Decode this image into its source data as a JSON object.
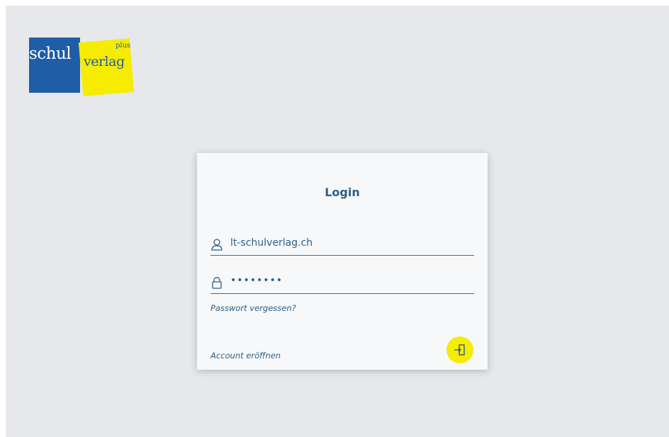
{
  "logo": {
    "part1": "schul",
    "part2": "verlag",
    "part3": "plus"
  },
  "login": {
    "title": "Login",
    "username_value": "lt-schulverlag.ch",
    "password_value": "••••••••",
    "forgot_password_label": "Passwort vergessen?",
    "create_account_label": "Account eröffnen"
  },
  "icons": {
    "user": "user-icon",
    "lock": "lock-icon",
    "login": "login-door-icon"
  },
  "colors": {
    "background": "#e6e8eb",
    "card": "#f7f8f9",
    "accent_blue": "#2d5f86",
    "brand_blue": "#1f5da8",
    "brand_yellow": "#f5ec00"
  }
}
